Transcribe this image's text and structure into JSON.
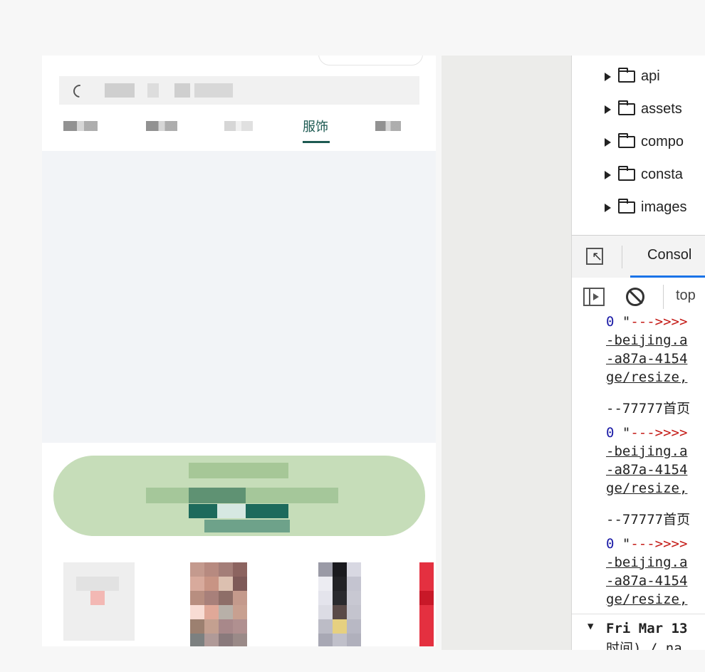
{
  "phone": {
    "tabs": [
      {
        "label": "精选",
        "state": "blurred"
      },
      {
        "label": "福星",
        "state": "blurred"
      },
      {
        "label": "· ·",
        "state": "blurred"
      },
      {
        "label": "服饰",
        "state": "active"
      },
      {
        "label": "● 专",
        "state": "blurred"
      }
    ],
    "accent_color": "#1d5a52",
    "banner_color": "#c6ddb9"
  },
  "devtools": {
    "tree": [
      {
        "label": "api"
      },
      {
        "label": "assets"
      },
      {
        "label": "compo"
      },
      {
        "label": "consta"
      },
      {
        "label": "images"
      }
    ],
    "console_tab": "Consol",
    "context": "top",
    "logs": [
      {
        "kind": "object",
        "lines": [
          "0 \"--->>>>",
          "-beijing.a",
          "-a87a-4154",
          "ge/resize,"
        ]
      },
      {
        "kind": "text",
        "lines": [
          "--77777首页"
        ]
      },
      {
        "kind": "object",
        "lines": [
          "0 \"--->>>>",
          "-beijing.a",
          "-a87a-4154",
          "ge/resize,"
        ]
      },
      {
        "kind": "text",
        "lines": [
          "--77777首页"
        ]
      },
      {
        "kind": "object",
        "lines": [
          "0 \"--->>>>",
          "-beijing.a",
          "-a87a-4154",
          "ge/resize,"
        ]
      }
    ],
    "group_line1": "Fri Mar 13",
    "group_line2": "时间) /  na",
    "console_accent": "#1a73e8"
  }
}
